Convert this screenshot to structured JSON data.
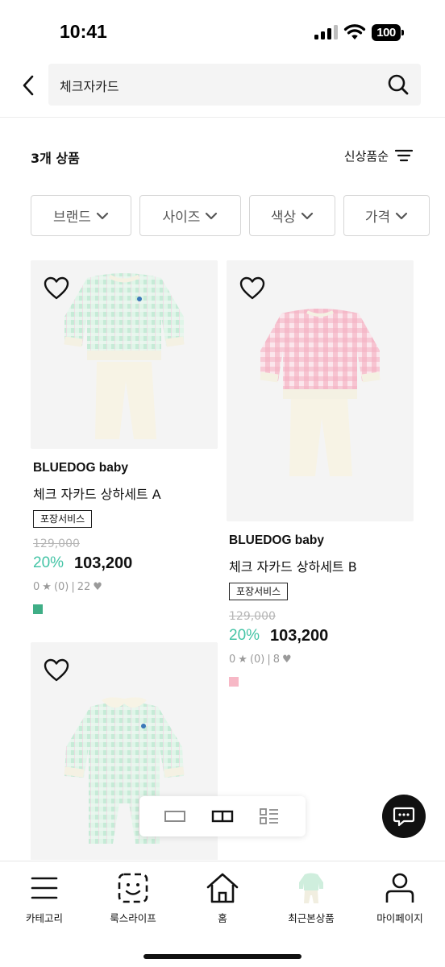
{
  "status_bar": {
    "time": "10:41",
    "battery": "100"
  },
  "search": {
    "query": "체크자카드"
  },
  "results": {
    "count_label": "3개 상품",
    "sort_label": "신상품순"
  },
  "filters": [
    {
      "label": "브랜드"
    },
    {
      "label": "사이즈"
    },
    {
      "label": "색상"
    },
    {
      "label": "가격"
    }
  ],
  "products": [
    {
      "brand": "BLUEDOG baby",
      "name": "체크 자카드 상하세트 A",
      "badge": "포장서비스",
      "original_price": "129,000",
      "discount": "20%",
      "price": "103,200",
      "rating": "0",
      "review_count": "(0)",
      "likes": "22",
      "color": "#3fae86",
      "garment": "mint top and cream pants"
    },
    {
      "brand": "BLUEDOG baby",
      "name": "체크 자카드 상하세트 B",
      "badge": "포장서비스",
      "original_price": "129,000",
      "discount": "20%",
      "price": "103,200",
      "rating": "0",
      "review_count": "(0)",
      "likes": "8",
      "color": "#f7b8c6",
      "garment": "pink top and cream pants"
    },
    {
      "garment": "mint check romper"
    }
  ],
  "view_modes": [
    "single-view-icon",
    "grid-view-icon",
    "list-view-icon"
  ],
  "chat": {
    "icon": "chat-bubble-icon"
  },
  "bottom_nav": [
    {
      "label": "카테고리",
      "icon": "menu-icon"
    },
    {
      "label": "룩스라이프",
      "icon": "scan-face-icon"
    },
    {
      "label": "홈",
      "icon": "home-icon"
    },
    {
      "label": "최근본상품",
      "icon": "recent-product-thumbnail"
    },
    {
      "label": "마이페이지",
      "icon": "user-icon"
    }
  ],
  "colors": {
    "accent_discount": "#44c4a6",
    "text": "#111111",
    "muted": "#9a9a9a"
  }
}
